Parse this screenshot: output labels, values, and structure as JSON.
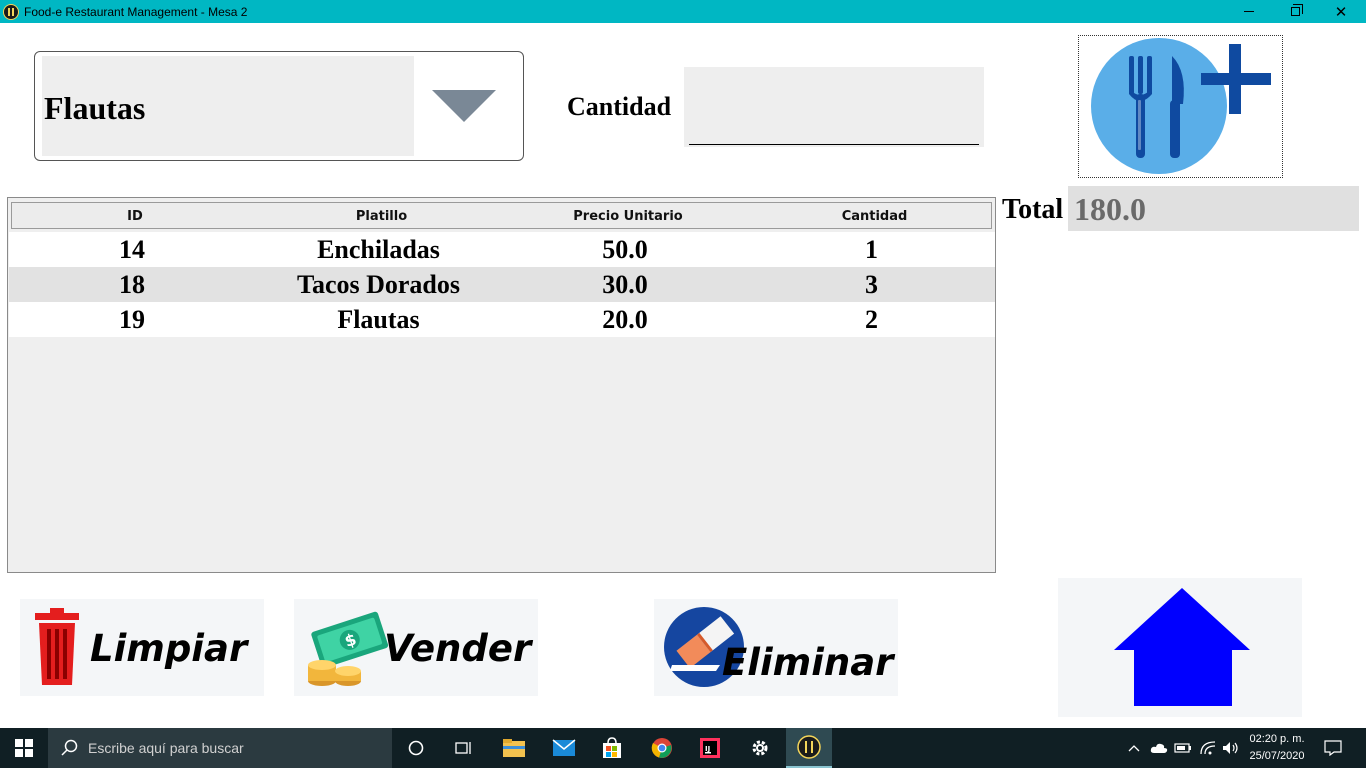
{
  "window": {
    "title": "Food-e Restaurant Management - Mesa 2"
  },
  "order_form": {
    "dish_selected": "Flautas",
    "quantity_label": "Cantidad",
    "quantity_value": ""
  },
  "total": {
    "label": "Total",
    "value": "180.0"
  },
  "table": {
    "columns": [
      "ID",
      "Platillo",
      "Precio Unitario",
      "Cantidad"
    ],
    "rows": [
      [
        "14",
        "Enchiladas",
        "50.0",
        "1"
      ],
      [
        "18",
        "Tacos Dorados",
        "30.0",
        "3"
      ],
      [
        "19",
        "Flautas",
        "20.0",
        "2"
      ]
    ]
  },
  "buttons": {
    "limpiar": "Limpiar",
    "vender": "Vender",
    "eliminar": "Eliminar"
  },
  "icons": {
    "add_dish": "cutlery-plus-icon",
    "clear": "trash-icon",
    "sell": "money-icon",
    "delete": "eraser-icon",
    "home": "home-icon"
  },
  "taskbar": {
    "search_placeholder": "Escribe aquí para buscar",
    "time": "02:20 p. m.",
    "date": "25/07/2020"
  },
  "colors": {
    "titlebar": "#00b7c3",
    "accent_blue": "#0000ff",
    "plate_blue": "#5aaee8"
  }
}
